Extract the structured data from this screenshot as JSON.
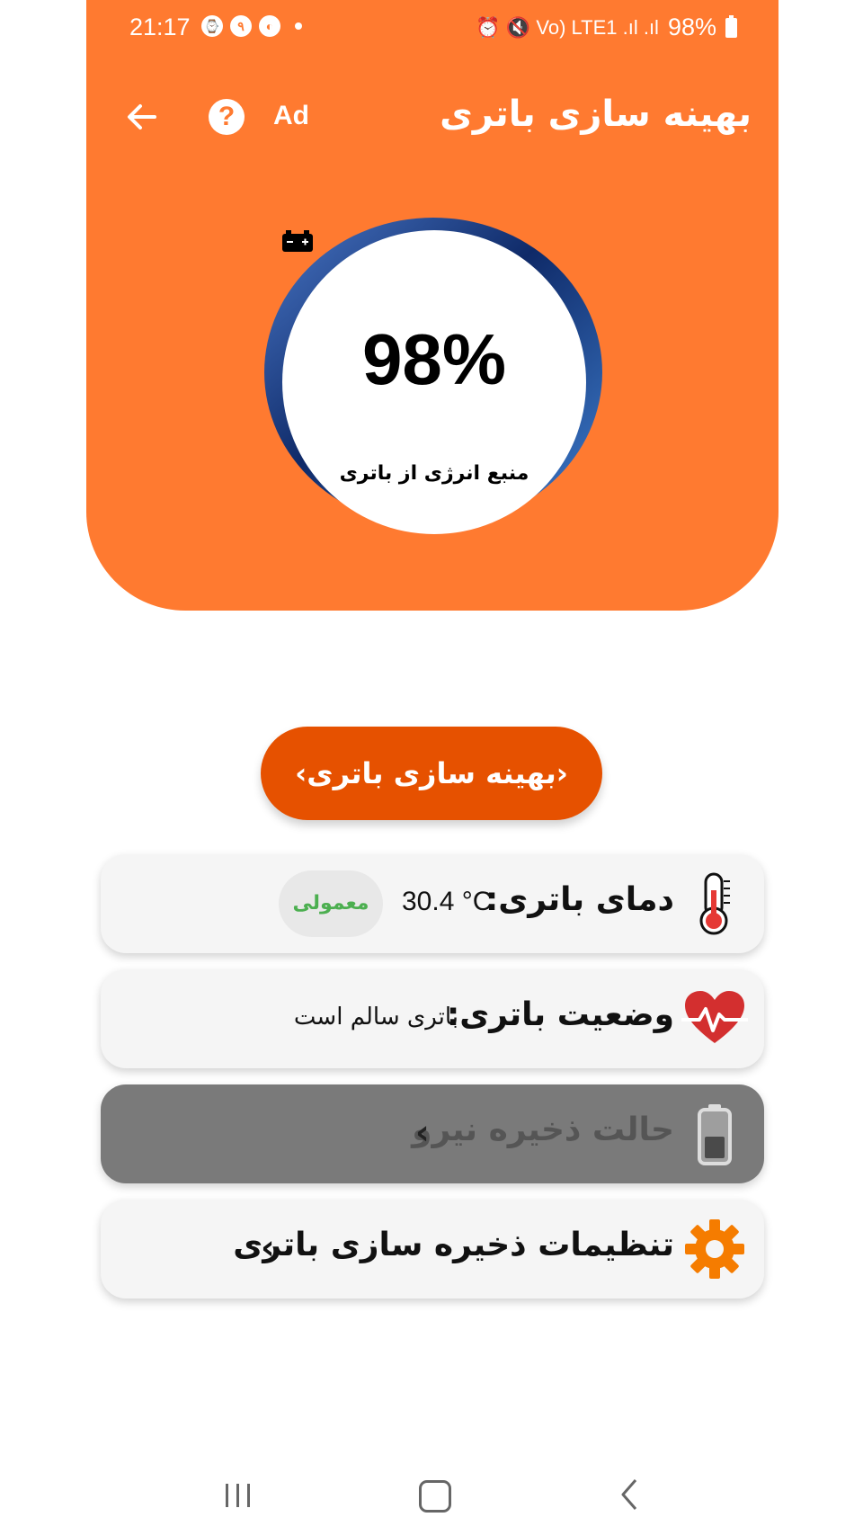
{
  "status_bar": {
    "time": "21:17",
    "left_icon_badge": "۹",
    "right_glyphs": "⏰ 🔇 Vo) LTE1 .ıl .ıl",
    "battery_text": "98%"
  },
  "app_bar": {
    "title": "بهینه سازی باتری",
    "help_label": "?",
    "ad_label": "Ad",
    "back_icon": "arrow-left-icon"
  },
  "gauge": {
    "percent_text": "98%",
    "level_fraction": 0.98,
    "source_label": "منبع انرژی از باتری"
  },
  "optimize_button": {
    "label": "‹بهینه سازی باتری›"
  },
  "cards": {
    "temperature": {
      "title": "دمای باتری:",
      "value": "30.4 °C",
      "badge": "معمولی",
      "badge_color": "#4CAF50"
    },
    "health": {
      "title": "وضعیت باتری:",
      "value": "باتری سالم است"
    },
    "power_saving": {
      "title": "حالت ذخیره نیرو",
      "chevron": "‹",
      "enabled": false
    },
    "saver_settings": {
      "title": "تنظیمات ذخیره سازی باتری",
      "chevron": "‹"
    }
  },
  "colors": {
    "header_bg": "#FF7A30",
    "button_bg": "#E65100",
    "gauge_ring": "#1E3A7A",
    "gear": "#F57C00",
    "heart": "#D32F2F"
  }
}
